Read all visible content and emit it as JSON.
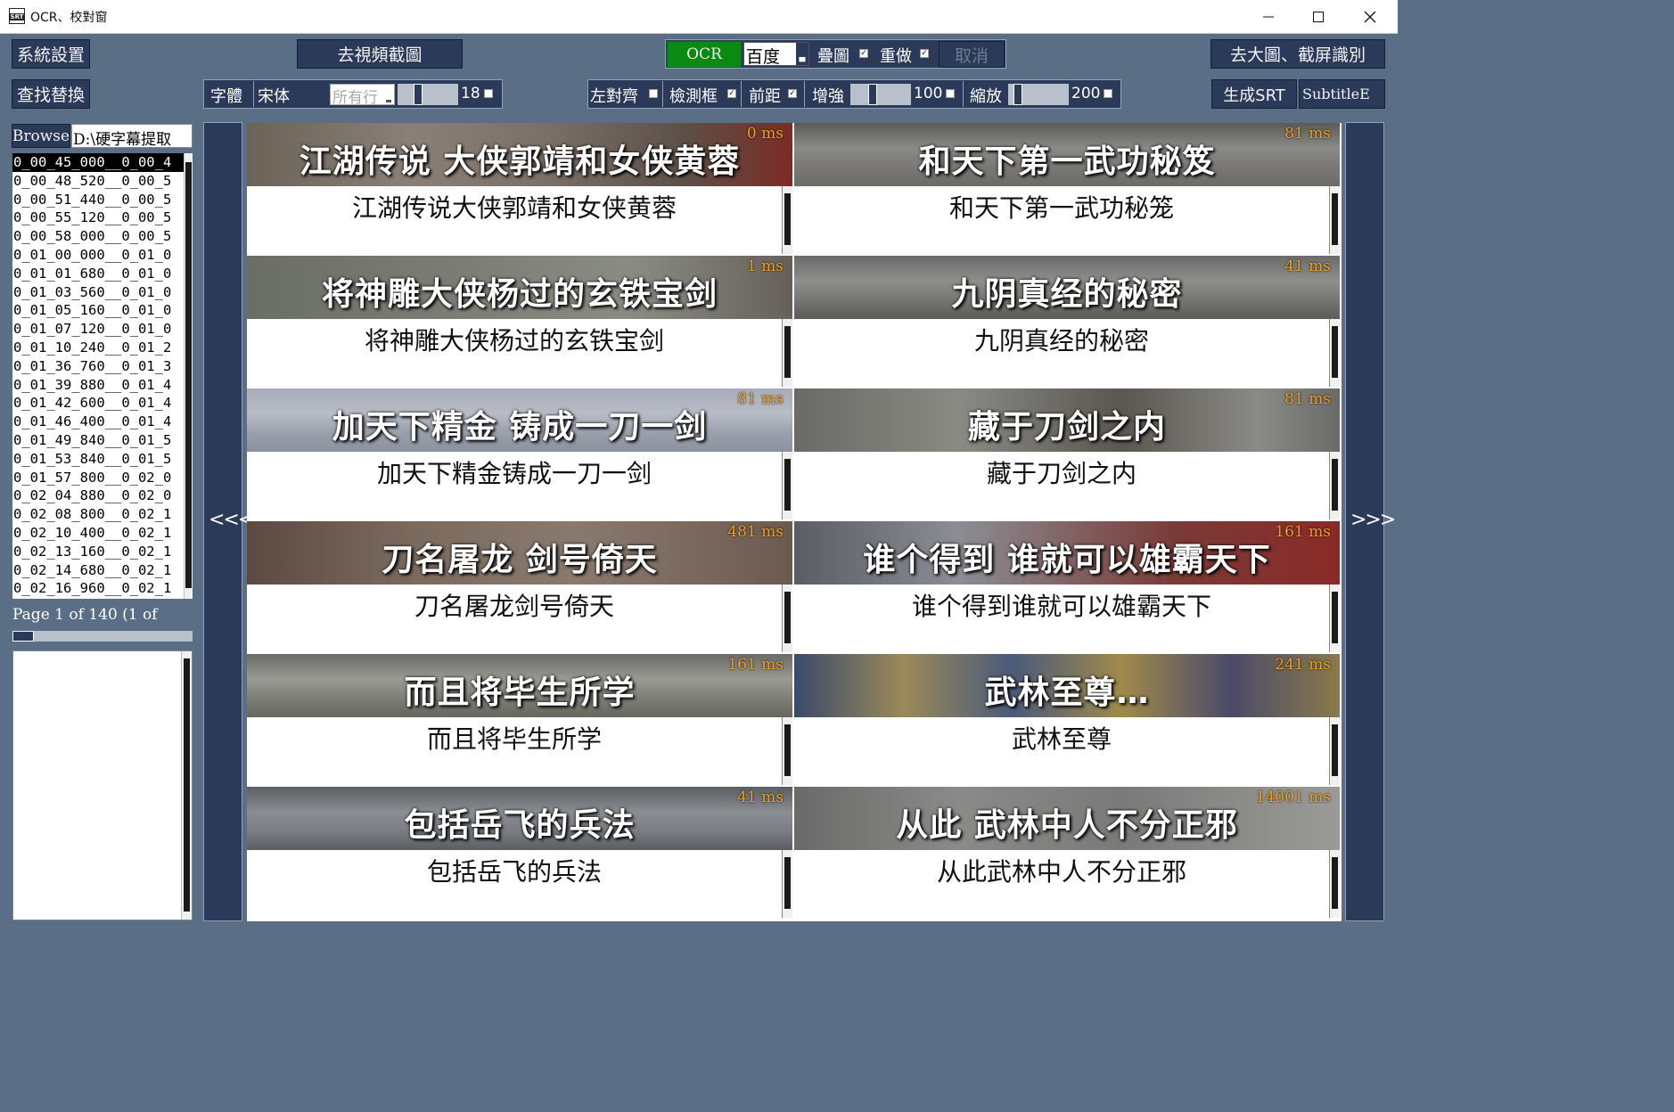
{
  "window": {
    "title": "OCR、校對窗",
    "icon_text": "SRT"
  },
  "toolbar1": {
    "system_settings": "系統設置",
    "goto_screenshot": "去視頻截圖",
    "ocr": "OCR",
    "engine": "百度",
    "overlay": "疊圖",
    "redo": "重做",
    "cancel": "取消",
    "goto_big": "去大圖、截屏識別"
  },
  "toolbar2": {
    "find_replace": "查找替換",
    "font_label": "字體",
    "font_name": "宋体",
    "rows_placeholder": "所有行",
    "font_size": "18",
    "left_align": "左對齊",
    "detect_box": "檢測框",
    "front_dist": "前距",
    "enhance": "增強",
    "enhance_value": "100",
    "enhance_level": 0.35,
    "zoom": "縮放",
    "zoom_value": "200",
    "zoom_level": 0.1,
    "gen_srt": "生成SRT",
    "subtitle_edit": "SubtitleE"
  },
  "left": {
    "browse": "Browse",
    "path": "D:\\硬字幕提取",
    "files": [
      "0_00_45_000__0_00_4",
      "0_00_48_520__0_00_5",
      "0_00_51_440__0_00_5",
      "0_00_55_120__0_00_5",
      "0_00_58_000__0_00_5",
      "0_01_00_000__0_01_0",
      "0_01_01_680__0_01_0",
      "0_01_03_560__0_01_0",
      "0_01_05_160__0_01_0",
      "0_01_07_120__0_01_0",
      "0_01_10_240__0_01_2",
      "0_01_36_760__0_01_3",
      "0_01_39_880__0_01_4",
      "0_01_42_600__0_01_4",
      "0_01_46_400__0_01_4",
      "0_01_49_840__0_01_5",
      "0_01_53_840__0_01_5",
      "0_01_57_800__0_02_0",
      "0_02_04_880__0_02_0",
      "0_02_08_800__0_02_1",
      "0_02_10_400__0_02_1",
      "0_02_13_160__0_02_1",
      "0_02_14_680__0_02_1",
      "0_02_16_960__0_02_1"
    ],
    "page_info": "Page 1 of 140 (1 of"
  },
  "nav": {
    "prev": "<<<",
    "next": ">>>"
  },
  "cards": [
    {
      "image_text": "江湖传说  大侠郭靖和女侠黄蓉",
      "ms": "0 ms",
      "ocr": "江湖传说大侠郭靖和女侠黄蓉"
    },
    {
      "image_text": "和天下第一武功秘笈",
      "ms": "81 ms",
      "ocr": "和天下第一武功秘笼"
    },
    {
      "image_text": "将神雕大侠杨过的玄铁宝剑",
      "ms": "1 ms",
      "ocr": "将神雕大侠杨过的玄铁宝剑"
    },
    {
      "image_text": "九阴真经的秘密",
      "ms": "41 ms",
      "ocr": "九阴真经的秘密"
    },
    {
      "image_text": "加天下精金  铸成一刀一剑",
      "ms": "81 ms",
      "ocr": "加天下精金铸成一刀一剑"
    },
    {
      "image_text": "藏于刀剑之内",
      "ms": "81 ms",
      "ocr": "藏于刀剑之内"
    },
    {
      "image_text": "刀名屠龙  剑号倚天",
      "ms": "481 ms",
      "ocr": "刀名屠龙剑号倚天"
    },
    {
      "image_text": "谁个得到  谁就可以雄霸天下",
      "ms": "161 ms",
      "ocr": "谁个得到谁就可以雄霸天下"
    },
    {
      "image_text": "而且将毕生所学",
      "ms": "161 ms",
      "ocr": "而且将毕生所学"
    },
    {
      "image_text": "武林至尊…",
      "ms": "241 ms",
      "ocr": "武林至尊"
    },
    {
      "image_text": "包括岳飞的兵法",
      "ms": "41 ms",
      "ocr": "包括岳飞的兵法"
    },
    {
      "image_text": "从此  武林中人不分正邪",
      "ms": "14001 ms",
      "ocr": "从此武林中人不分正邪"
    }
  ],
  "colors": {
    "bg": "#5a6f85",
    "button": "#2b3a58",
    "ocr_green": "#0a8a12",
    "ms_orange": "#f0a020"
  }
}
